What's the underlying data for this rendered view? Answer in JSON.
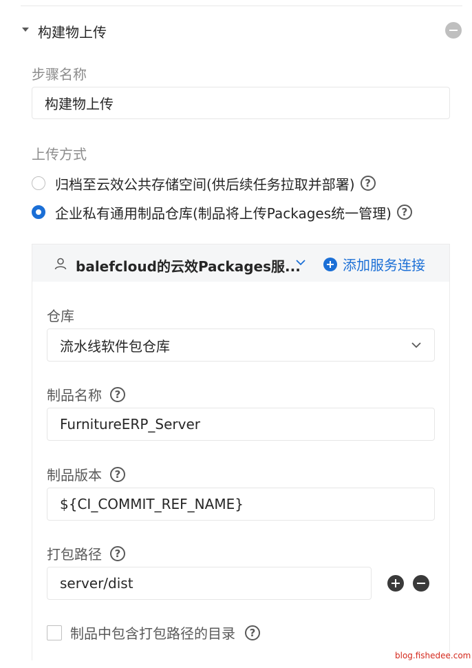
{
  "step": {
    "title": "构建物上传",
    "remove_icon": "minus-circle-icon",
    "name_label": "步骤名称",
    "name_value": "构建物上传"
  },
  "upload": {
    "label": "上传方式",
    "options": [
      {
        "text": "归档至云效公共存储空间(供后续任务拉取并部署)",
        "selected": false
      },
      {
        "text": "企业私有通用制品仓库(制品将上传Packages统一管理)",
        "selected": true
      }
    ],
    "help_glyph": "?"
  },
  "connection": {
    "name": "balefcloud的云效Packages服...",
    "add_label": "添加服务连接",
    "user_icon": "user-icon",
    "chevron_icon": "chevron-down-icon"
  },
  "repo": {
    "label": "仓库",
    "value": "流水线软件包仓库"
  },
  "artifact_name": {
    "label": "制品名称",
    "value": "FurnitureERP_Server"
  },
  "artifact_version": {
    "label": "制品版本",
    "value": "${CI_COMMIT_REF_NAME}"
  },
  "package_path": {
    "label": "打包路径",
    "value": "server/dist"
  },
  "include_dir": {
    "label": "制品中包含打包路径的目录",
    "checked": false
  },
  "watermark": "blog.fishedee.com",
  "colors": {
    "accent": "#1b6fd6",
    "watermark": "#d4281c"
  }
}
